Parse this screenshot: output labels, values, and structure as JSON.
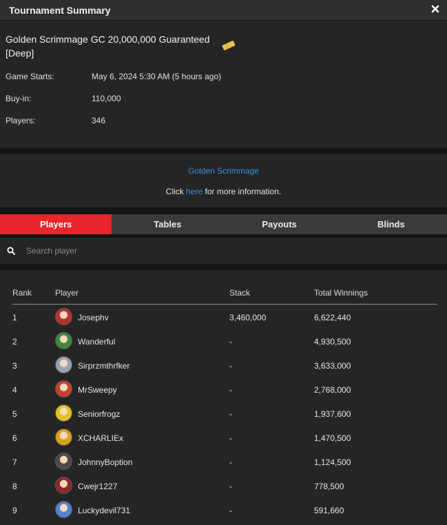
{
  "window": {
    "title": "Tournament Summary"
  },
  "tournament": {
    "name": "Golden Scrimmage GC 20,000,000 Guaranteed [Deep]",
    "fields": [
      {
        "label": "Game Starts:",
        "value": "May 6, 2024 5:30 AM (5 hours ago)"
      },
      {
        "label": "Buy-in:",
        "value": "110,000"
      },
      {
        "label": "Players:",
        "value": "346"
      }
    ]
  },
  "info_link": {
    "series": "Golden Scrimmage",
    "prefix": "Click ",
    "link": "here",
    "suffix": " for more information."
  },
  "tabs": [
    {
      "label": "Players",
      "active": true
    },
    {
      "label": "Tables",
      "active": false
    },
    {
      "label": "Payouts",
      "active": false
    },
    {
      "label": "Blinds",
      "active": false
    }
  ],
  "search": {
    "placeholder": "Search player",
    "value": ""
  },
  "table": {
    "headers": {
      "rank": "Rank",
      "player": "Player",
      "stack": "Stack",
      "winnings": "Total Winnings"
    },
    "rows": [
      {
        "rank": "1",
        "player": "Josephv",
        "stack": "3,460,000",
        "winnings": "6,622,440",
        "avatar_color": "#b8302e"
      },
      {
        "rank": "2",
        "player": "Wanderful",
        "stack": "-",
        "winnings": "4,930,500",
        "avatar_color": "#3f8a3a"
      },
      {
        "rank": "3",
        "player": "Sirprzmthrfker",
        "stack": "-",
        "winnings": "3,633,000",
        "avatar_color": "#9aa4b0"
      },
      {
        "rank": "4",
        "player": "MrSweepy",
        "stack": "-",
        "winnings": "2,768,000",
        "avatar_color": "#c8402e"
      },
      {
        "rank": "5",
        "player": "Seniorfrogz",
        "stack": "-",
        "winnings": "1,937,600",
        "avatar_color": "#e2c21e"
      },
      {
        "rank": "6",
        "player": "XCHARLIEx",
        "stack": "-",
        "winnings": "1,470,500",
        "avatar_color": "#d9a21c"
      },
      {
        "rank": "7",
        "player": "JohnnyBoption",
        "stack": "-",
        "winnings": "1,124,500",
        "avatar_color": "#4a4a4a"
      },
      {
        "rank": "8",
        "player": "Cwejr1227",
        "stack": "-",
        "winnings": "778,500",
        "avatar_color": "#8e2a2a"
      },
      {
        "rank": "9",
        "player": "Luckydevil731",
        "stack": "-",
        "winnings": "591,660",
        "avatar_color": "#5a7fd0"
      }
    ]
  },
  "icons": {
    "close": "close-icon",
    "ticket": "ticket-icon",
    "search": "search-icon"
  }
}
